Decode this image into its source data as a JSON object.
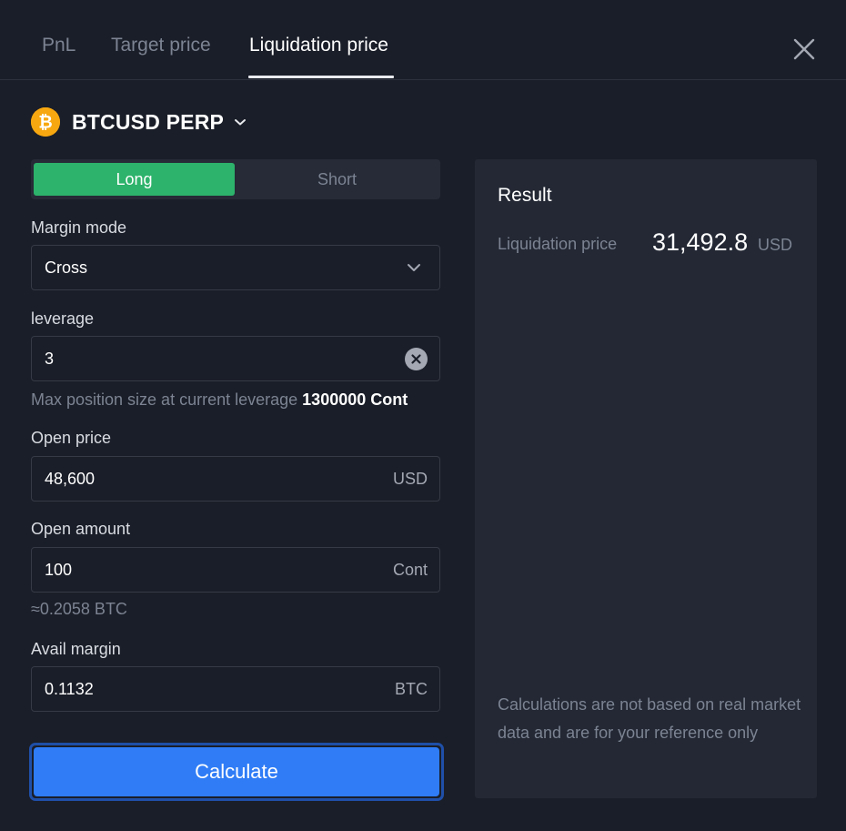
{
  "tabs": [
    {
      "label": "PnL",
      "active": false
    },
    {
      "label": "Target price",
      "active": false
    },
    {
      "label": "Liquidation price",
      "active": true
    }
  ],
  "symbol": {
    "name": "BTCUSD PERP",
    "icon": "bitcoin-icon"
  },
  "side": {
    "long_label": "Long",
    "short_label": "Short",
    "selected": "Long"
  },
  "margin_mode": {
    "label": "Margin mode",
    "value": "Cross"
  },
  "leverage": {
    "label": "leverage",
    "value": "3",
    "hint_prefix": "Max position size at current leverage",
    "hint_value": "1300000 Cont"
  },
  "open_price": {
    "label": "Open price",
    "value": "48,600",
    "unit": "USD"
  },
  "open_amount": {
    "label": "Open amount",
    "value": "100",
    "unit": "Cont",
    "approx": "≈0.2058 BTC"
  },
  "avail_margin": {
    "label": "Avail margin",
    "value": "0.1132",
    "unit": "BTC"
  },
  "calculate_label": "Calculate",
  "result": {
    "title": "Result",
    "label": "Liquidation price",
    "value": "31,492.8",
    "unit": "USD",
    "disclaimer": "Calculations are not based on real market data and are for your reference only"
  },
  "colors": {
    "background": "#1a1e28",
    "panel": "#232834",
    "long_green": "#2db36b",
    "calculate_blue": "#2f7cf6",
    "bitcoin_orange": "#f7a70f",
    "muted_text": "#7c8392"
  }
}
